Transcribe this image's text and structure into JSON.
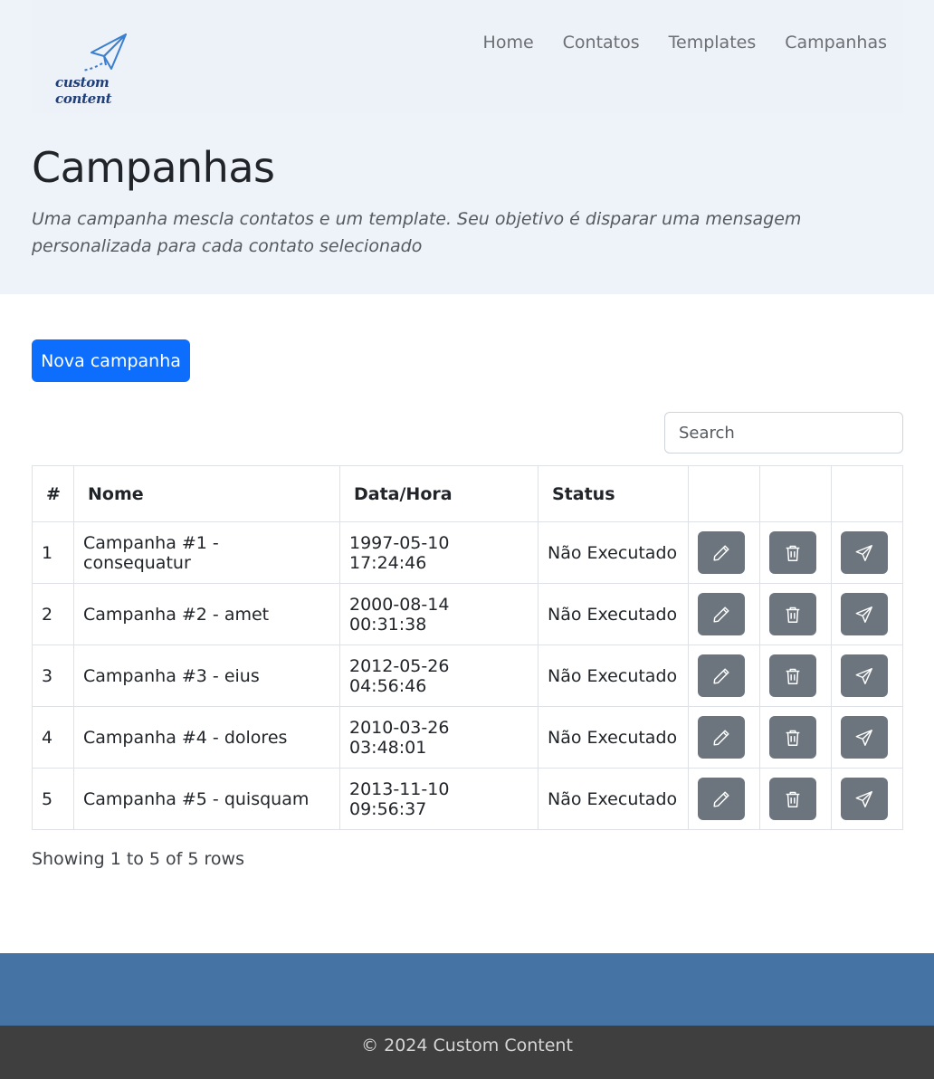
{
  "brand": {
    "logo_text": "custom content"
  },
  "nav": {
    "items": [
      "Home",
      "Contatos",
      "Templates",
      "Campanhas"
    ]
  },
  "header": {
    "title": "Campanhas",
    "subtitle": "Uma campanha mescla contatos e um template. Seu objetivo é disparar uma mensagem personalizada para cada contato selecionado"
  },
  "actions": {
    "new_campaign": "Nova campanha"
  },
  "search": {
    "placeholder": "Search"
  },
  "table": {
    "headers": [
      "#",
      "Nome",
      "Data/Hora",
      "Status"
    ],
    "rows": [
      {
        "id": "1",
        "nome": "Campanha #1 - consequatur",
        "data": "1997-05-10 17:24:46",
        "status": "Não Executado"
      },
      {
        "id": "2",
        "nome": "Campanha #2 - amet",
        "data": "2000-08-14 00:31:38",
        "status": "Não Executado"
      },
      {
        "id": "3",
        "nome": "Campanha #3 - eius",
        "data": "2012-05-26 04:56:46",
        "status": "Não Executado"
      },
      {
        "id": "4",
        "nome": "Campanha #4 - dolores",
        "data": "2010-03-26 03:48:01",
        "status": "Não Executado"
      },
      {
        "id": "5",
        "nome": "Campanha #5 - quisquam",
        "data": "2013-11-10 09:56:37",
        "status": "Não Executado"
      }
    ],
    "row_icons": [
      "pencil-icon",
      "trash-icon",
      "send-icon"
    ],
    "summary": "Showing 1 to 5 of 5 rows"
  },
  "footer": {
    "copyright": "© 2024 Custom Content"
  },
  "colors": {
    "primary": "#0d6efd",
    "secondary": "#6c757d",
    "hero_bg": "#eef2f9",
    "footer_band": "#4573a3",
    "footer_bar": "#3f3f3f"
  }
}
